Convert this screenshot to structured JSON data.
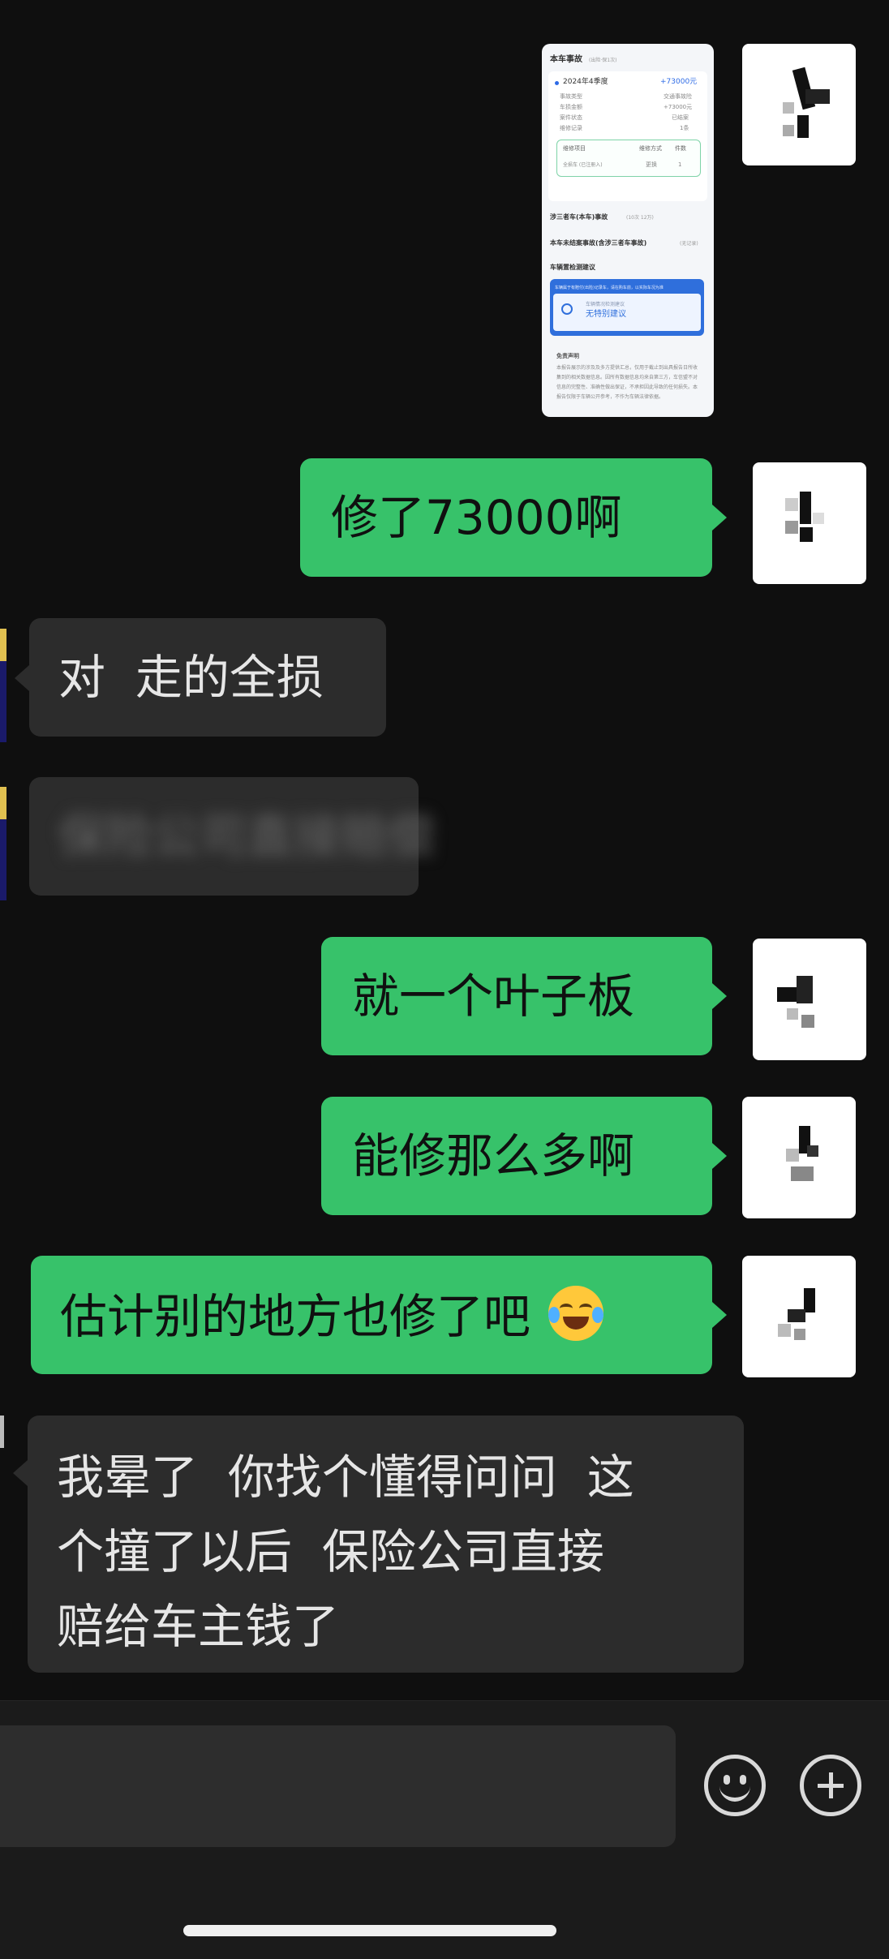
{
  "screenshot_card": {
    "title": "本车事故",
    "title_note": "(出险·保1次)",
    "period": "2024年4季度",
    "amount": "+73000元",
    "rows": [
      {
        "label": "事故类型",
        "value": "交通事故险"
      },
      {
        "label": "车损金额",
        "value": "+73000元"
      },
      {
        "label": "案件状态",
        "value": "已结案"
      },
      {
        "label": "维修记录",
        "value": "1条"
      }
    ],
    "table_headers": [
      "维修项目",
      "维修方式",
      "件数"
    ],
    "table_row": [
      "全损车 (已注册入)",
      "更换",
      "1"
    ],
    "section_1": "涉三者车(本车)事故",
    "section_1_note": "(10次 12万)",
    "section_2": "本车未结案事故(含涉三者车事故)",
    "section_2_note": "(无记录)",
    "section_3": "车辆置检测建议",
    "notice_text": "车辆属于有赔付(出险)记录车，请在购车前，以实际车况为准",
    "advice_label": "车辆情况检测建议",
    "advice_value": "无特别建议",
    "disclaimer_title": "免责声明",
    "disclaimer_text": "本报告展示的涉及及多方提供汇总，仅用于截止到出具报告日所收集到的相关数据信息。因所有数据信息均来自第三方，车信盟不对信息的完整性、准确性做出保证，不承担因此导致的任何损失。本报告仅限于车辆公开参考，不作为车辆法律依据。"
  },
  "messages": [
    {
      "side": "out",
      "text": "修了73000啊"
    },
    {
      "side": "in",
      "text": "对  走的全损"
    },
    {
      "side": "in",
      "text": "保险公司直接赔偿",
      "blurred": true
    },
    {
      "side": "out",
      "text": "就一个叶子板"
    },
    {
      "side": "out",
      "text": "能修那么多啊"
    },
    {
      "side": "out",
      "text": "估计别的地方也修了吧",
      "emoji": "crying-laughing"
    },
    {
      "side": "in",
      "lines": [
        "我晕了  你找个懂得问问  这",
        "个撞了以后  保险公司直接",
        "赔给车主钱了"
      ]
    }
  ],
  "input_bar": {
    "emoji_icon": "smiley-icon",
    "plus_icon": "plus-circle-icon"
  }
}
